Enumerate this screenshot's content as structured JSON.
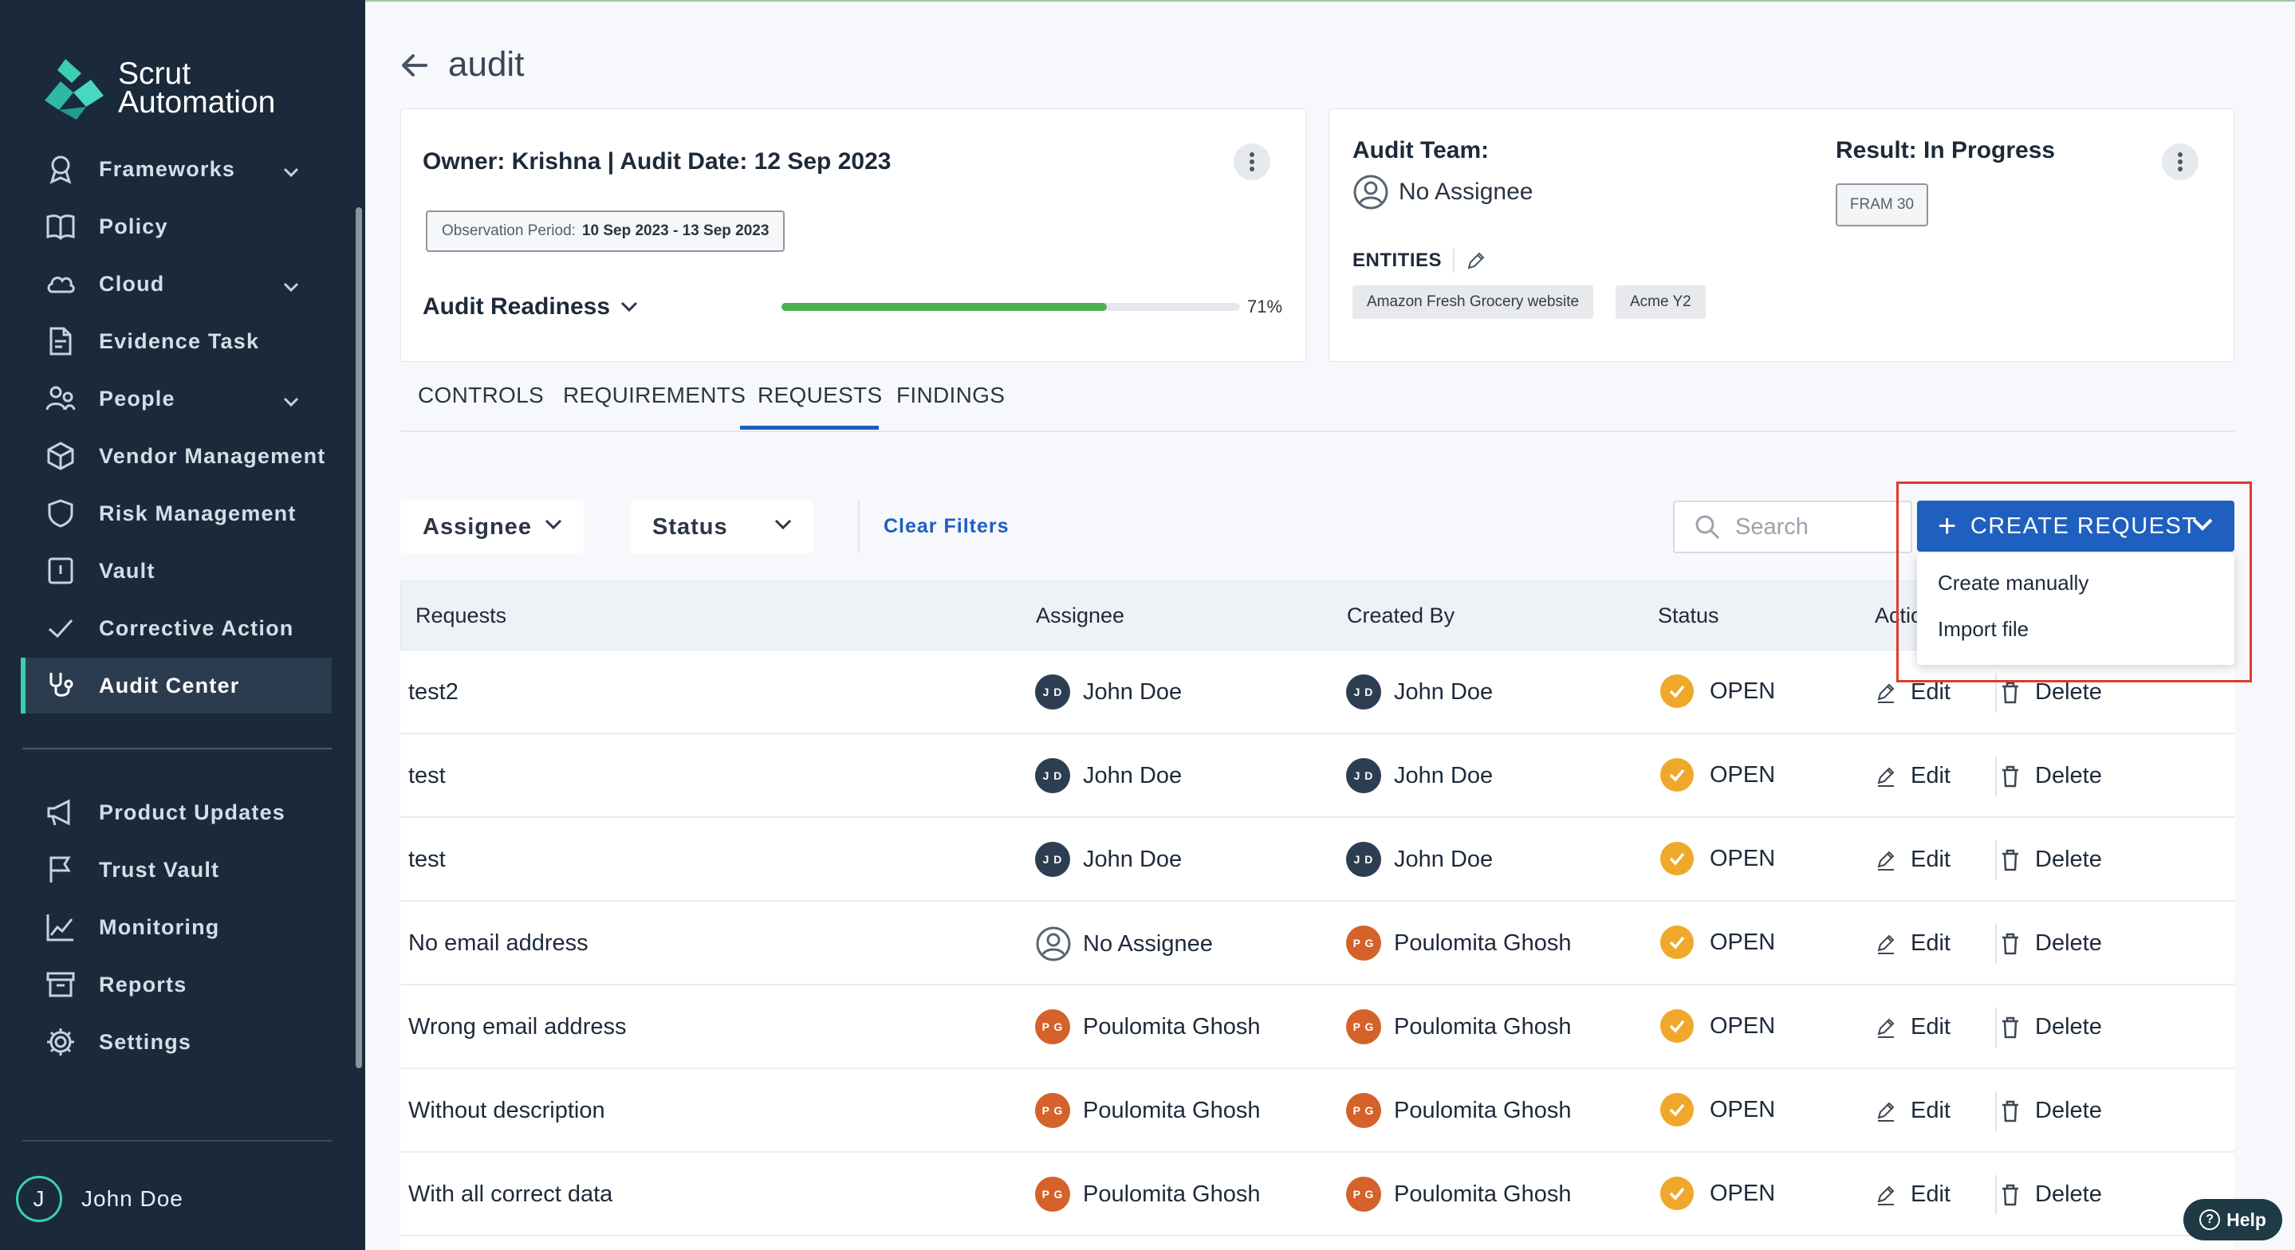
{
  "brand": {
    "name_line1": "Scrut",
    "name_line2": "Automation"
  },
  "sidebar": {
    "items": [
      {
        "label": "Frameworks",
        "icon": "award-icon",
        "has_chevron": true
      },
      {
        "label": "Policy",
        "icon": "book-icon",
        "has_chevron": false
      },
      {
        "label": "Cloud",
        "icon": "cloud-icon",
        "has_chevron": true
      },
      {
        "label": "Evidence Task",
        "icon": "document-icon",
        "has_chevron": false
      },
      {
        "label": "People",
        "icon": "people-icon",
        "has_chevron": true
      },
      {
        "label": "Vendor Management",
        "icon": "box-icon",
        "has_chevron": false
      },
      {
        "label": "Risk Management",
        "icon": "shield-icon",
        "has_chevron": false
      },
      {
        "label": "Vault",
        "icon": "vault-icon",
        "has_chevron": false
      },
      {
        "label": "Corrective Action",
        "icon": "check-icon",
        "has_chevron": false
      },
      {
        "label": "Audit Center",
        "icon": "stethoscope-icon",
        "has_chevron": false,
        "active": true
      }
    ],
    "secondary": [
      {
        "label": "Product Updates",
        "icon": "megaphone-icon"
      },
      {
        "label": "Trust Vault",
        "icon": "flag-icon"
      },
      {
        "label": "Monitoring",
        "icon": "chart-icon"
      },
      {
        "label": "Reports",
        "icon": "archive-icon"
      },
      {
        "label": "Settings",
        "icon": "gear-icon"
      }
    ],
    "user": {
      "initial": "J",
      "name": "John Doe"
    }
  },
  "header": {
    "title": "audit"
  },
  "audit_card": {
    "owner_line": "Owner: Krishna | Audit Date: 12 Sep 2023",
    "observation_label": "Observation Period:",
    "observation_value": "10 Sep 2023 - 13 Sep 2023",
    "readiness_label": "Audit Readiness",
    "readiness_percent": 71,
    "readiness_text": "71%"
  },
  "team_card": {
    "team_label": "Audit Team:",
    "assignee": "No Assignee",
    "result_label": "Result: In Progress",
    "framework_badge": "FRAM 30",
    "entities_label": "ENTITIES",
    "entities": [
      "Amazon Fresh Grocery website",
      "Acme Y2"
    ]
  },
  "tabs": [
    "CONTROLS",
    "REQUIREMENTS",
    "REQUESTS",
    "FINDINGS"
  ],
  "active_tab": "REQUESTS",
  "filters": {
    "assignee": "Assignee",
    "status": "Status",
    "clear": "Clear Filters",
    "search_placeholder": "Search"
  },
  "create_button": {
    "label": "CREATE REQUEST",
    "menu": [
      "Create manually",
      "Import file"
    ]
  },
  "table": {
    "headers": {
      "requests": "Requests",
      "assignee": "Assignee",
      "created_by": "Created By",
      "status": "Status",
      "actions": "Actio"
    },
    "rows": [
      {
        "request": "test2",
        "assignee": "John Doe",
        "assignee_initials": "J D",
        "created_by": "John Doe",
        "created_initials": "J D",
        "status": "OPEN"
      },
      {
        "request": "test",
        "assignee": "John Doe",
        "assignee_initials": "J D",
        "created_by": "John Doe",
        "created_initials": "J D",
        "status": "OPEN"
      },
      {
        "request": "test",
        "assignee": "John Doe",
        "assignee_initials": "J D",
        "created_by": "John Doe",
        "created_initials": "J D",
        "status": "OPEN"
      },
      {
        "request": "No email address",
        "assignee": "No Assignee",
        "assignee_initials": "",
        "created_by": "Poulomita Ghosh",
        "created_initials": "P G",
        "status": "OPEN"
      },
      {
        "request": "Wrong email address",
        "assignee": "Poulomita Ghosh",
        "assignee_initials": "P G",
        "created_by": "Poulomita Ghosh",
        "created_initials": "P G",
        "status": "OPEN"
      },
      {
        "request": "Without description",
        "assignee": "Poulomita Ghosh",
        "assignee_initials": "P G",
        "created_by": "Poulomita Ghosh",
        "created_initials": "P G",
        "status": "OPEN"
      },
      {
        "request": "With all correct data",
        "assignee": "Poulomita Ghosh",
        "assignee_initials": "P G",
        "created_by": "Poulomita Ghosh",
        "created_initials": "P G",
        "status": "OPEN"
      }
    ],
    "edit_label": "Edit",
    "delete_label": "Delete"
  },
  "help": {
    "label": "Help"
  },
  "colors": {
    "sidebar_bg": "#1a2a3a",
    "accent": "#1f5fbf",
    "teal": "#3ad0b0",
    "status_open": "#f0a82a",
    "pg_avatar": "#d4622a",
    "jd_avatar": "#2d3e52"
  }
}
